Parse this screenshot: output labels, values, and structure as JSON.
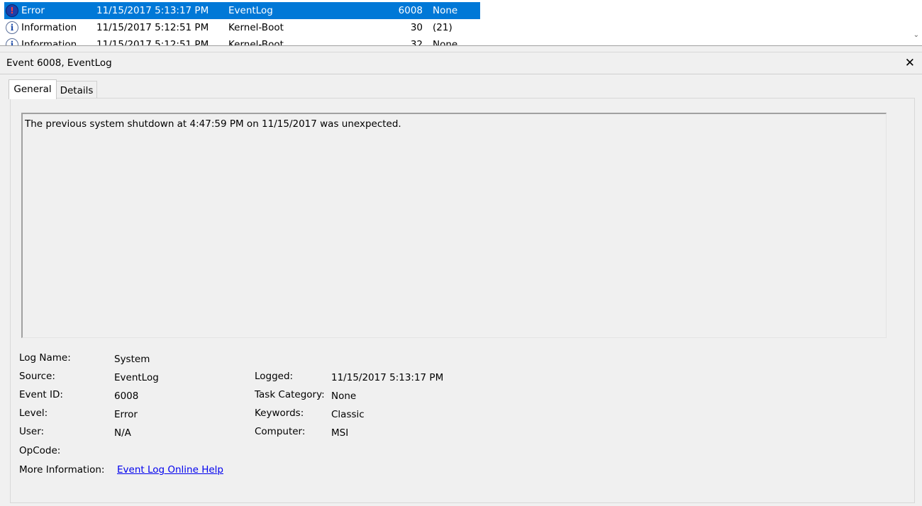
{
  "event_list": {
    "rows": [
      {
        "level": "Error",
        "date": "11/15/2017 5:13:17 PM",
        "source": "EventLog",
        "id": "6008",
        "category": "None"
      },
      {
        "level": "Information",
        "date": "11/15/2017 5:12:51 PM",
        "source": "Kernel-Boot",
        "id": "30",
        "category": "(21)"
      },
      {
        "level": "Information",
        "date": "11/15/2017 5:12:51 PM",
        "source": "Kernel-Boot",
        "id": "32",
        "category": "None"
      }
    ]
  },
  "detail": {
    "title": "Event 6008, EventLog",
    "close_glyph": "✕",
    "tabs": [
      "General",
      "Details"
    ],
    "message": "The previous system shutdown at 4:47:59 PM on 11/15/2017 was unexpected."
  },
  "fields": {
    "log_name": {
      "label": "Log Name:",
      "value": "System"
    },
    "source": {
      "label": "Source:",
      "value": "EventLog"
    },
    "event_id": {
      "label": "Event ID:",
      "value": "6008"
    },
    "level": {
      "label": "Level:",
      "value": "Error"
    },
    "user": {
      "label": "User:",
      "value": "N/A"
    },
    "opcode": {
      "label": "OpCode:",
      "value": ""
    },
    "more_info": {
      "label": "More Information:",
      "link": "Event Log Online Help"
    },
    "logged": {
      "label": "Logged:",
      "value": "11/15/2017 5:13:17 PM"
    },
    "task_category": {
      "label": "Task Category:",
      "value": "None"
    },
    "keywords": {
      "label": "Keywords:",
      "value": "Classic"
    },
    "computer": {
      "label": "Computer:",
      "value": "MSI"
    }
  },
  "icons": {
    "error": "error-icon",
    "information": "information-icon",
    "close": "close-icon"
  },
  "colors": {
    "selection": "#0078d7",
    "link": "#0000ee"
  }
}
